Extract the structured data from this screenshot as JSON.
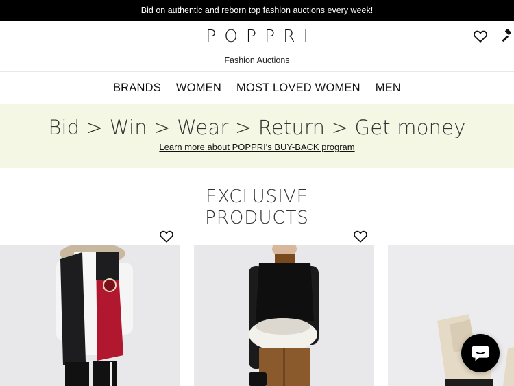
{
  "announcement": {
    "text": "Bid on authentic and reborn top fashion auctions every week!"
  },
  "header": {
    "logo_text": "POPPRI",
    "logo_subtitle": "Fashion Auctions",
    "icons": [
      "heart-icon",
      "gavel-icon"
    ]
  },
  "nav": {
    "items": [
      "BRANDS",
      "WOMEN",
      "MOST LOVED WOMEN",
      "MEN"
    ]
  },
  "promo": {
    "headline": "Bid > Win > Wear > Return > Get money",
    "link": "Learn more about POPPRI's BUY-BACK program",
    "background": "#f4f7e3"
  },
  "section": {
    "title_line1": "EXCLUSIVE",
    "title_line2": "PRODUCTS"
  },
  "products": [
    {
      "icon": "heart-icon"
    },
    {
      "icon": "heart-icon"
    },
    {
      "icon": "heart-icon"
    }
  ],
  "chat": {
    "icon": "chat-icon",
    "color": "#000000"
  }
}
